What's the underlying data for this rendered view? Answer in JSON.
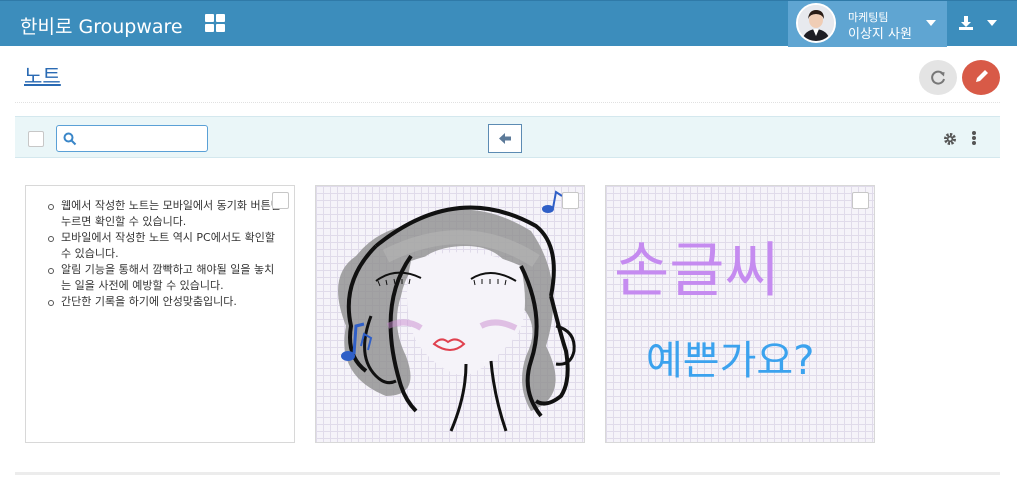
{
  "header": {
    "brand": "한비로 Groupware",
    "user_team": "마케팅팀",
    "user_name": "이상지 사원",
    "colors": {
      "bar": "#3c8dbc",
      "user_box": "#5fa5d2"
    }
  },
  "page": {
    "title": "노트"
  },
  "search": {
    "placeholder": ""
  },
  "notes": [
    {
      "type": "text",
      "lines": [
        "웹에서 작성한 노트는 모바일에서 동기화 버튼만 누르면 확인할 수 있습니다.",
        "모바일에서 작성한 노트 역시 PC에서도 확인할 수 있습니다.",
        "알림 기능을 통해서 깜빡하고 해야될 일을 놓치는 일을 사전에 예방할 수 있습니다.",
        "간단한 기록을 하기에 안성맞춤입니다."
      ]
    },
    {
      "type": "drawing",
      "icon": "girl-sketch-drawing"
    },
    {
      "type": "drawing",
      "handwriting_line1": "손글씨",
      "handwriting_line2": "예쁜가요?"
    }
  ],
  "icons": [
    "apps-grid-icon",
    "download-icon",
    "refresh-icon",
    "pencil-icon",
    "search-icon",
    "arrow-left-icon",
    "gear-icon",
    "more-vertical-icon"
  ],
  "accent": {
    "edit": "#d85a47",
    "refresh": "#e4e4e4",
    "toolbar": "#eaf6f8"
  }
}
